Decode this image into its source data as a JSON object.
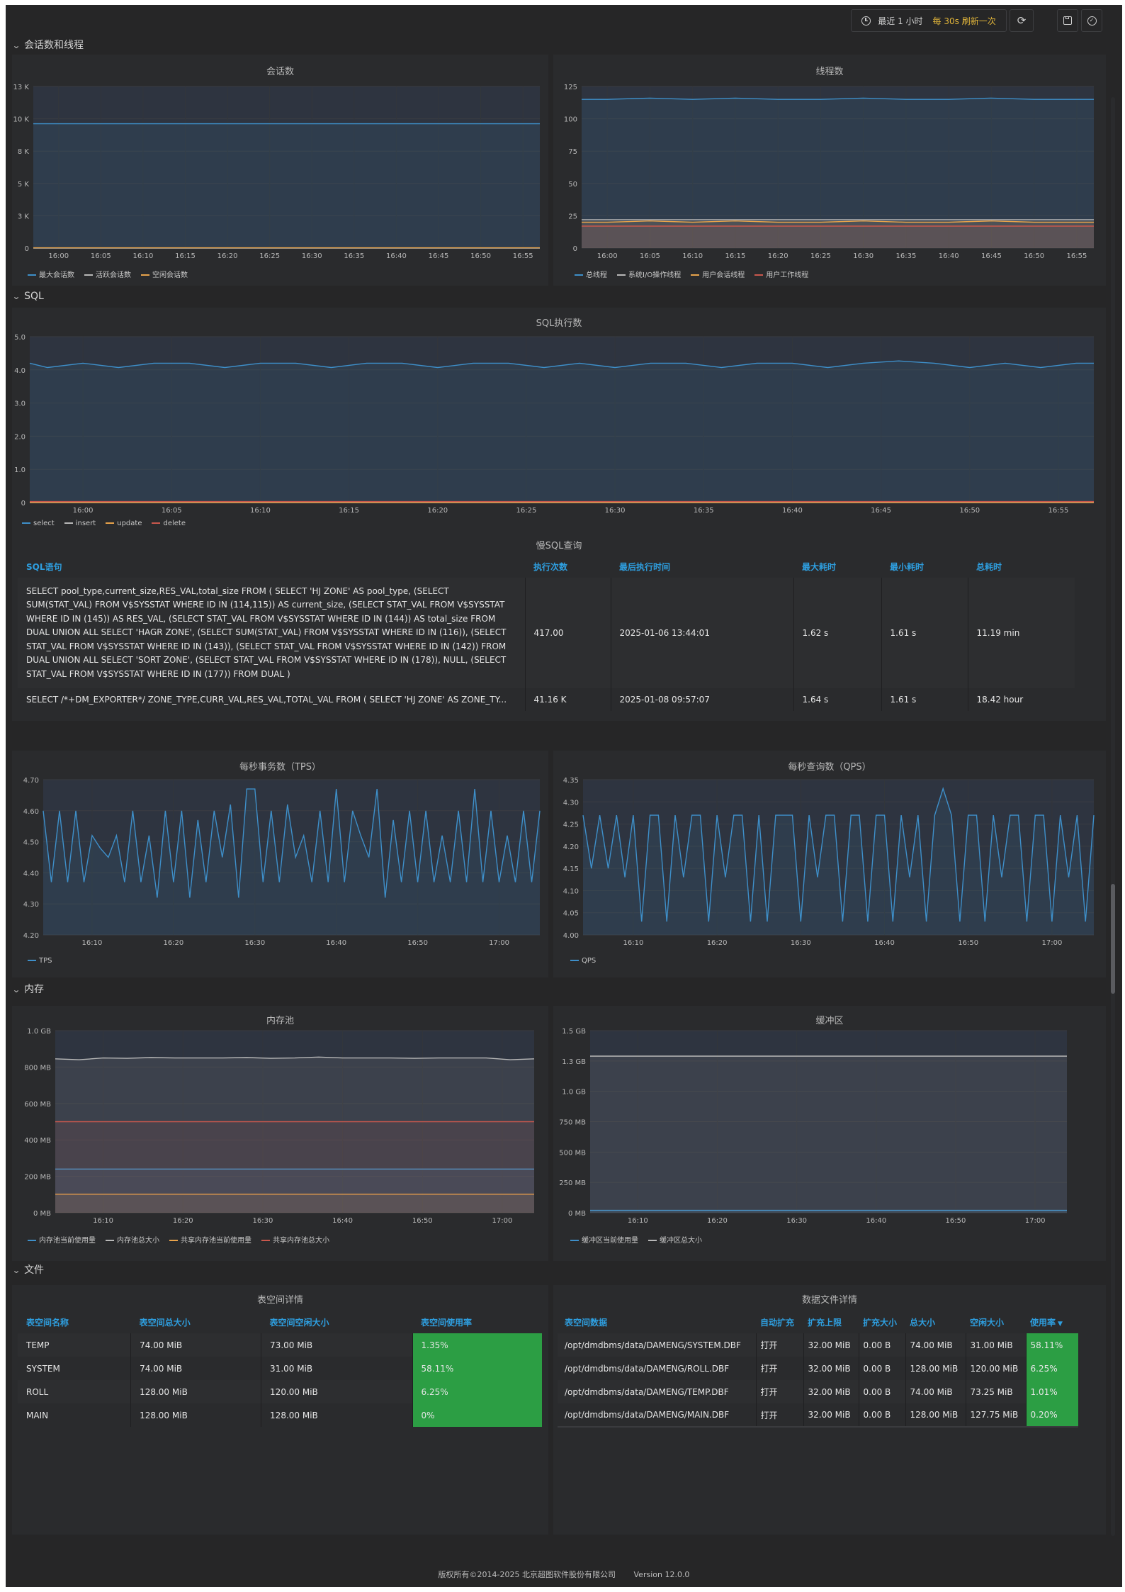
{
  "toolbar": {
    "time_range": "最近 1 小时",
    "refresh": "每 30s 刷新一次"
  },
  "sections": {
    "sessions": "会话数和线程",
    "sql": "SQL",
    "memory": "内存",
    "files": "文件"
  },
  "colors": {
    "blue": "#3e8fc9",
    "gray": "#b8b8b8",
    "orange": "#e8a34b",
    "red": "#c9584d",
    "green_cell": "#2c9e44",
    "header_blue": "#2e9fe0"
  },
  "chart_data": [
    {
      "id": "sessions",
      "type": "line",
      "title": "会话数",
      "y_ticks": [
        "13 K",
        "10 K",
        "8 K",
        "5 K",
        "3 K",
        "0"
      ],
      "ylim": [
        0,
        13000
      ],
      "x_ticks": [
        "16:00",
        "16:05",
        "16:10",
        "16:15",
        "16:20",
        "16:25",
        "16:30",
        "16:35",
        "16:40",
        "16:45",
        "16:50",
        "16:55"
      ],
      "x": [
        "15:57",
        "16:00",
        "16:05",
        "16:10",
        "16:15",
        "16:20",
        "16:25",
        "16:30",
        "16:35",
        "16:40",
        "16:45",
        "16:50",
        "16:55",
        "16:57"
      ],
      "series": [
        {
          "name": "最大会话数",
          "color": "#3e8fc9",
          "values": [
            10000,
            10000,
            10000,
            10000,
            10000,
            10000,
            10000,
            10000,
            10000,
            10000,
            10000,
            10000,
            10000,
            10000
          ]
        },
        {
          "name": "活跃会话数",
          "color": "#b8b8b8",
          "values": [
            2,
            2,
            2,
            2,
            2,
            2,
            2,
            2,
            2,
            2,
            2,
            2,
            2,
            2
          ]
        },
        {
          "name": "空闲会话数",
          "color": "#e8a34b",
          "values": [
            20,
            20,
            20,
            20,
            20,
            20,
            20,
            20,
            20,
            20,
            20,
            20,
            20,
            20
          ]
        }
      ]
    },
    {
      "id": "threads",
      "type": "line",
      "title": "线程数",
      "y_ticks": [
        "125",
        "100",
        "75",
        "50",
        "25",
        "0"
      ],
      "ylim": [
        0,
        125
      ],
      "x_ticks": [
        "16:00",
        "16:05",
        "16:10",
        "16:15",
        "16:20",
        "16:25",
        "16:30",
        "16:35",
        "16:40",
        "16:45",
        "16:50",
        "16:55"
      ],
      "x": [
        "15:57",
        "16:00",
        "16:05",
        "16:10",
        "16:15",
        "16:20",
        "16:25",
        "16:30",
        "16:35",
        "16:40",
        "16:45",
        "16:50",
        "16:55",
        "16:57"
      ],
      "series": [
        {
          "name": "总线程",
          "color": "#3e8fc9",
          "values": [
            115,
            115,
            116,
            115,
            116,
            115,
            115,
            116,
            115,
            115,
            116,
            115,
            115,
            115
          ]
        },
        {
          "name": "系统I/O操作线程",
          "color": "#b8b8b8",
          "values": [
            22,
            22,
            22,
            22,
            22,
            22,
            22,
            22,
            22,
            22,
            22,
            22,
            22,
            22
          ]
        },
        {
          "name": "用户会话线程",
          "color": "#e8a34b",
          "values": [
            20,
            20,
            21,
            20,
            21,
            20,
            20,
            21,
            20,
            20,
            21,
            20,
            20,
            20
          ]
        },
        {
          "name": "用户工作线程",
          "color": "#c9584d",
          "values": [
            17,
            17,
            17,
            17,
            17,
            17,
            17,
            17,
            17,
            17,
            17,
            17,
            17,
            17
          ]
        }
      ]
    },
    {
      "id": "sql_exec",
      "type": "line",
      "title": "SQL执行数",
      "y_ticks": [
        "5.0",
        "4.0",
        "3.0",
        "2.0",
        "1.0",
        "0"
      ],
      "ylim": [
        0,
        5
      ],
      "x_ticks": [
        "16:00",
        "16:05",
        "16:10",
        "16:15",
        "16:20",
        "16:25",
        "16:30",
        "16:35",
        "16:40",
        "16:45",
        "16:50",
        "16:55"
      ],
      "x": [
        "15:57",
        "15:58",
        "16:00",
        "16:02",
        "16:04",
        "16:06",
        "16:08",
        "16:10",
        "16:12",
        "16:14",
        "16:16",
        "16:18",
        "16:20",
        "16:22",
        "16:24",
        "16:26",
        "16:28",
        "16:30",
        "16:32",
        "16:34",
        "16:36",
        "16:38",
        "16:40",
        "16:42",
        "16:44",
        "16:46",
        "16:48",
        "16:50",
        "16:52",
        "16:54",
        "16:56",
        "16:57"
      ],
      "series": [
        {
          "name": "select",
          "color": "#3e8fc9",
          "values": [
            4.2,
            4.07,
            4.2,
            4.07,
            4.2,
            4.2,
            4.07,
            4.2,
            4.2,
            4.07,
            4.2,
            4.2,
            4.07,
            4.2,
            4.2,
            4.07,
            4.2,
            4.07,
            4.2,
            4.2,
            4.07,
            4.2,
            4.2,
            4.07,
            4.2,
            4.27,
            4.2,
            4.07,
            4.2,
            4.07,
            4.2,
            4.2
          ]
        },
        {
          "name": "insert",
          "color": "#b8b8b8",
          "values": [
            0,
            0,
            0,
            0,
            0,
            0,
            0,
            0,
            0,
            0,
            0,
            0,
            0,
            0,
            0,
            0,
            0,
            0,
            0,
            0,
            0,
            0,
            0,
            0,
            0,
            0,
            0,
            0,
            0,
            0,
            0,
            0
          ]
        },
        {
          "name": "update",
          "color": "#e8a34b",
          "values": [
            0,
            0,
            0,
            0,
            0,
            0,
            0,
            0,
            0,
            0,
            0,
            0,
            0,
            0,
            0,
            0,
            0,
            0,
            0,
            0,
            0,
            0,
            0,
            0,
            0,
            0,
            0,
            0,
            0,
            0,
            0,
            0
          ]
        },
        {
          "name": "delete",
          "color": "#c9584d",
          "values": [
            0.03,
            0.03,
            0.03,
            0.03,
            0.03,
            0.03,
            0.03,
            0.03,
            0.03,
            0.03,
            0.03,
            0.03,
            0.03,
            0.03,
            0.03,
            0.03,
            0.03,
            0.03,
            0.03,
            0.03,
            0.03,
            0.03,
            0.03,
            0.03,
            0.03,
            0.03,
            0.03,
            0.03,
            0.03,
            0.03,
            0.03,
            0.03
          ]
        }
      ]
    },
    {
      "id": "tps",
      "type": "line",
      "title": "每秒事务数（TPS）",
      "y_ticks": [
        "4.70",
        "4.60",
        "4.50",
        "4.40",
        "4.30",
        "4.20"
      ],
      "ylim": [
        4.2,
        4.7
      ],
      "x_ticks": [
        "16:10",
        "16:20",
        "16:30",
        "16:40",
        "16:50",
        "17:00"
      ],
      "x": [
        "16:04",
        "16:05",
        "16:06",
        "16:07",
        "16:08",
        "16:09",
        "16:10",
        "16:11",
        "16:12",
        "16:13",
        "16:14",
        "16:15",
        "16:16",
        "16:17",
        "16:18",
        "16:19",
        "16:20",
        "16:21",
        "16:22",
        "16:23",
        "16:24",
        "16:25",
        "16:26",
        "16:27",
        "16:28",
        "16:29",
        "16:30",
        "16:31",
        "16:32",
        "16:33",
        "16:34",
        "16:35",
        "16:36",
        "16:37",
        "16:38",
        "16:39",
        "16:40",
        "16:41",
        "16:42",
        "16:43",
        "16:44",
        "16:45",
        "16:46",
        "16:47",
        "16:48",
        "16:49",
        "16:50",
        "16:51",
        "16:52",
        "16:53",
        "16:54",
        "16:55",
        "16:56",
        "16:57",
        "16:58",
        "16:59",
        "17:00",
        "17:01",
        "17:02",
        "17:03",
        "17:04",
        "17:05"
      ],
      "series": [
        {
          "name": "TPS",
          "color": "#3e8fc9",
          "values": [
            4.6,
            4.37,
            4.6,
            4.37,
            4.6,
            4.37,
            4.52,
            4.48,
            4.45,
            4.52,
            4.37,
            4.6,
            4.37,
            4.52,
            4.32,
            4.6,
            4.37,
            4.6,
            4.32,
            4.57,
            4.37,
            4.6,
            4.45,
            4.62,
            4.32,
            4.67,
            4.67,
            4.37,
            4.6,
            4.37,
            4.62,
            4.45,
            4.52,
            4.37,
            4.6,
            4.37,
            4.67,
            4.37,
            4.6,
            4.52,
            4.45,
            4.67,
            4.32,
            4.57,
            4.37,
            4.6,
            4.37,
            4.6,
            4.37,
            4.52,
            4.37,
            4.6,
            4.37,
            4.67,
            4.37,
            4.6,
            4.37,
            4.52,
            4.37,
            4.6,
            4.37,
            4.6
          ]
        }
      ]
    },
    {
      "id": "qps",
      "type": "line",
      "title": "每秒查询数（QPS）",
      "y_ticks": [
        "4.35",
        "4.30",
        "4.25",
        "4.20",
        "4.15",
        "4.10",
        "4.05",
        "4.00"
      ],
      "ylim": [
        4.0,
        4.35
      ],
      "x_ticks": [
        "16:10",
        "16:20",
        "16:30",
        "16:40",
        "16:50",
        "17:00"
      ],
      "x": [
        "16:04",
        "16:05",
        "16:06",
        "16:07",
        "16:08",
        "16:09",
        "16:10",
        "16:11",
        "16:12",
        "16:13",
        "16:14",
        "16:15",
        "16:16",
        "16:17",
        "16:18",
        "16:19",
        "16:20",
        "16:21",
        "16:22",
        "16:23",
        "16:24",
        "16:25",
        "16:26",
        "16:27",
        "16:28",
        "16:29",
        "16:30",
        "16:31",
        "16:32",
        "16:33",
        "16:34",
        "16:35",
        "16:36",
        "16:37",
        "16:38",
        "16:39",
        "16:40",
        "16:41",
        "16:42",
        "16:43",
        "16:44",
        "16:45",
        "16:46",
        "16:47",
        "16:48",
        "16:49",
        "16:50",
        "16:51",
        "16:52",
        "16:53",
        "16:54",
        "16:55",
        "16:56",
        "16:57",
        "16:58",
        "16:59",
        "17:00",
        "17:01",
        "17:02",
        "17:03",
        "17:04",
        "17:05"
      ],
      "series": [
        {
          "name": "QPS",
          "color": "#3e8fc9",
          "values": [
            4.27,
            4.15,
            4.27,
            4.15,
            4.27,
            4.13,
            4.27,
            4.03,
            4.27,
            4.27,
            4.03,
            4.27,
            4.13,
            4.27,
            4.27,
            4.03,
            4.27,
            4.13,
            4.27,
            4.27,
            4.03,
            4.27,
            4.03,
            4.27,
            4.27,
            4.27,
            4.03,
            4.27,
            4.13,
            4.27,
            4.27,
            4.03,
            4.27,
            4.27,
            4.03,
            4.27,
            4.27,
            4.03,
            4.27,
            4.13,
            4.27,
            4.03,
            4.27,
            4.33,
            4.27,
            4.03,
            4.27,
            4.27,
            4.03,
            4.27,
            4.13,
            4.27,
            4.27,
            4.03,
            4.27,
            4.27,
            4.03,
            4.27,
            4.13,
            4.27,
            4.03,
            4.27
          ]
        }
      ]
    },
    {
      "id": "mempool",
      "type": "line",
      "title": "内存池",
      "y_ticks": [
        "1.0 GB",
        "800 MB",
        "600 MB",
        "400 MB",
        "200 MB",
        "0 MB"
      ],
      "ylim": [
        0,
        1000
      ],
      "x_ticks": [
        "16:10",
        "16:20",
        "16:30",
        "16:40",
        "16:50",
        "17:00"
      ],
      "x": [
        "16:04",
        "16:07",
        "16:10",
        "16:13",
        "16:16",
        "16:19",
        "16:22",
        "16:25",
        "16:28",
        "16:31",
        "16:34",
        "16:37",
        "16:40",
        "16:43",
        "16:46",
        "16:49",
        "16:52",
        "16:55",
        "16:58",
        "17:01",
        "17:04"
      ],
      "series": [
        {
          "name": "内存池当前使用量",
          "color": "#3e8fc9",
          "values": [
            240,
            240,
            240,
            240,
            240,
            240,
            240,
            240,
            240,
            240,
            240,
            240,
            240,
            240,
            240,
            240,
            240,
            240,
            240,
            240,
            240
          ]
        },
        {
          "name": "内存池总大小",
          "color": "#b8b8b8",
          "values": [
            845,
            840,
            850,
            848,
            852,
            850,
            850,
            850,
            852,
            848,
            850,
            855,
            850,
            850,
            850,
            848,
            850,
            850,
            850,
            840,
            845
          ]
        },
        {
          "name": "共享内存池当前使用量",
          "color": "#e8a34b",
          "values": [
            102,
            102,
            102,
            102,
            102,
            102,
            102,
            102,
            102,
            102,
            102,
            102,
            102,
            102,
            102,
            102,
            102,
            102,
            102,
            102,
            102
          ]
        },
        {
          "name": "共享内存池总大小",
          "color": "#c9584d",
          "values": [
            500,
            500,
            500,
            500,
            500,
            500,
            500,
            500,
            500,
            500,
            500,
            500,
            500,
            500,
            500,
            500,
            500,
            500,
            500,
            500,
            500
          ]
        }
      ]
    },
    {
      "id": "buffer",
      "type": "line",
      "title": "缓冲区",
      "y_ticks": [
        "1.5 GB",
        "1.3 GB",
        "1.0 GB",
        "750 MB",
        "500 MB",
        "250 MB",
        "0 MB"
      ],
      "ylim": [
        0,
        1500
      ],
      "x_ticks": [
        "16:10",
        "16:20",
        "16:30",
        "16:40",
        "16:50",
        "17:00"
      ],
      "x": [
        "16:04",
        "16:10",
        "16:20",
        "16:30",
        "16:40",
        "16:50",
        "17:00",
        "17:04"
      ],
      "series": [
        {
          "name": "缓冲区当前使用量",
          "color": "#3e8fc9",
          "values": [
            20,
            20,
            20,
            20,
            20,
            20,
            20,
            20
          ]
        },
        {
          "name": "缓冲区总大小",
          "color": "#b8b8b8",
          "values": [
            1290,
            1290,
            1290,
            1290,
            1290,
            1290,
            1290,
            1290
          ]
        }
      ]
    }
  ],
  "slow_sql": {
    "title": "慢SQL查询",
    "columns": [
      "SQL语句",
      "执行次数",
      "最后执行时间",
      "最大耗时",
      "最小耗时",
      "总耗时"
    ],
    "rows": [
      [
        "SELECT pool_type,current_size,RES_VAL,total_size FROM ( SELECT 'HJ ZONE' AS pool_type, (SELECT SUM(STAT_VAL) FROM V$SYSSTAT WHERE ID IN (114,115)) AS current_size, (SELECT STAT_VAL FROM V$SYSSTAT WHERE ID IN (145)) AS RES_VAL, (SELECT STAT_VAL FROM V$SYSSTAT WHERE ID IN (144)) AS total_size FROM DUAL UNION ALL SELECT 'HAGR ZONE', (SELECT SUM(STAT_VAL) FROM V$SYSSTAT WHERE ID IN (116)), (SELECT STAT_VAL FROM V$SYSSTAT WHERE ID IN (143)), (SELECT STAT_VAL FROM V$SYSSTAT WHERE ID IN (142)) FROM DUAL UNION ALL SELECT 'SORT ZONE', (SELECT STAT_VAL FROM V$SYSSTAT WHERE ID IN (178)), NULL, (SELECT STAT_VAL FROM V$SYSSTAT WHERE ID IN (177)) FROM DUAL )",
        "417.00",
        "2025-01-06 13:44:01",
        "1.62 s",
        "1.61 s",
        "11.19 min"
      ],
      [
        "SELECT /*+DM_EXPORTER*/ ZONE_TYPE,CURR_VAL,RES_VAL,TOTAL_VAL FROM ( SELECT 'HJ ZONE' AS ZONE_TY...",
        "41.16 K",
        "2025-01-08 09:57:07",
        "1.64 s",
        "1.61 s",
        "18.42 hour"
      ]
    ]
  },
  "tablespace": {
    "title": "表空间详情",
    "columns": [
      "表空间名称",
      "表空间总大小",
      "表空间空闲大小",
      "表空间使用率"
    ],
    "rows": [
      [
        "TEMP",
        "74.00 MiB",
        "73.00 MiB",
        "1.35%"
      ],
      [
        "SYSTEM",
        "74.00 MiB",
        "31.00 MiB",
        "58.11%"
      ],
      [
        "ROLL",
        "128.00 MiB",
        "120.00 MiB",
        "6.25%"
      ],
      [
        "MAIN",
        "128.00 MiB",
        "128.00 MiB",
        "0%"
      ]
    ]
  },
  "datafile": {
    "title": "数据文件详情",
    "columns": [
      "表空间数据",
      "自动扩充",
      "扩充上限",
      "扩充大小",
      "总大小",
      "空闲大小",
      "使用率"
    ],
    "sort_icon": "caret-down-icon",
    "rows": [
      [
        "/opt/dmdbms/data/DAMENG/SYSTEM.DBF",
        "打开",
        "32.00 MiB",
        "0.00 B",
        "74.00 MiB",
        "31.00 MiB",
        "58.11%"
      ],
      [
        "/opt/dmdbms/data/DAMENG/ROLL.DBF",
        "打开",
        "32.00 MiB",
        "0.00 B",
        "128.00 MiB",
        "120.00 MiB",
        "6.25%"
      ],
      [
        "/opt/dmdbms/data/DAMENG/TEMP.DBF",
        "打开",
        "32.00 MiB",
        "0.00 B",
        "74.00 MiB",
        "73.25 MiB",
        "1.01%"
      ],
      [
        "/opt/dmdbms/data/DAMENG/MAIN.DBF",
        "打开",
        "32.00 MiB",
        "0.00 B",
        "128.00 MiB",
        "127.75 MiB",
        "0.20%"
      ]
    ]
  },
  "footer": {
    "copyright": "版权所有©2014-2025 北京超图软件股份有限公司",
    "version": "Version 12.0.0"
  }
}
